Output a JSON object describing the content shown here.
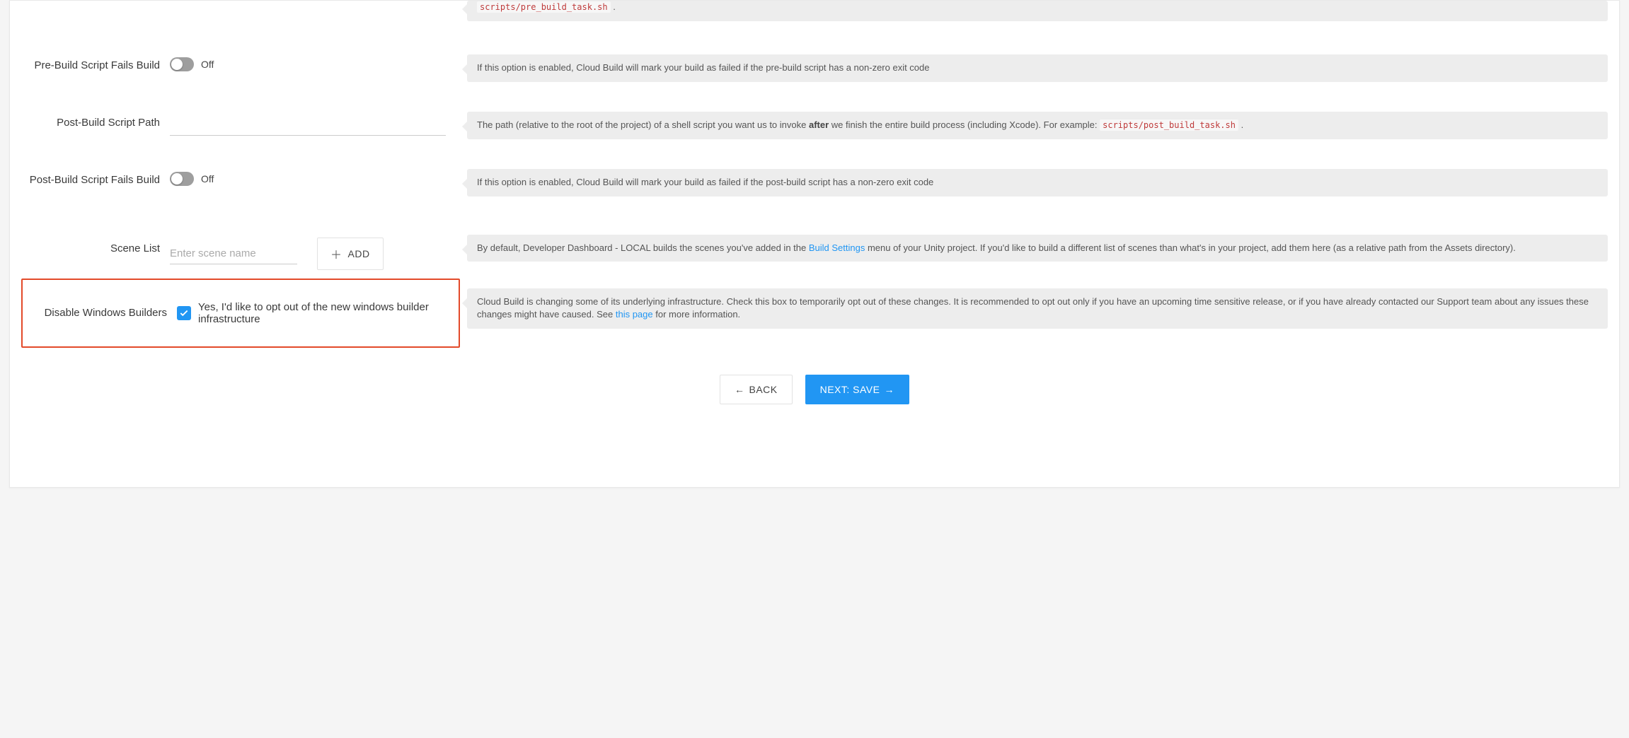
{
  "fields": {
    "pre_build_code_tail": "scripts/pre_build_task.sh",
    "pre_build_fails": {
      "label": "Pre-Build Script Fails Build",
      "state": "Off",
      "help": "If this option is enabled, Cloud Build will mark your build as failed if the pre-build script has a non-zero exit code"
    },
    "post_build_path": {
      "label": "Post-Build Script Path",
      "help_before": "The path (relative to the root of the project) of a shell script you want us to invoke ",
      "help_bold": "after",
      "help_after": " we finish the entire build process (including Xcode). For example: ",
      "help_code": "scripts/post_build_task.sh"
    },
    "post_build_fails": {
      "label": "Post-Build Script Fails Build",
      "state": "Off",
      "help": "If this option is enabled, Cloud Build will mark your build as failed if the post-build script has a non-zero exit code"
    },
    "scene_list": {
      "label": "Scene List",
      "placeholder": "Enter scene name",
      "add_button": "ADD",
      "help_before": "By default, Developer Dashboard - LOCAL builds the scenes you've added in the ",
      "help_link": "Build Settings",
      "help_after": " menu of your Unity project. If you'd like to build a different list of scenes than what's in your project, add them here (as a relative path from the Assets directory)."
    },
    "disable_windows": {
      "label": "Disable Windows Builders",
      "checkbox_label": "Yes, I'd like to opt out of the new windows builder infrastructure",
      "help_before": "Cloud Build is changing some of its underlying infrastructure. Check this box to temporarily opt out of these changes. It is recommended to opt out only if you have an upcoming time sensitive release, or if you have already contacted our Support team about any issues these changes might have caused. See ",
      "help_link": "this page",
      "help_after": " for more information."
    }
  },
  "footer": {
    "back": "BACK",
    "next": "NEXT: SAVE"
  }
}
